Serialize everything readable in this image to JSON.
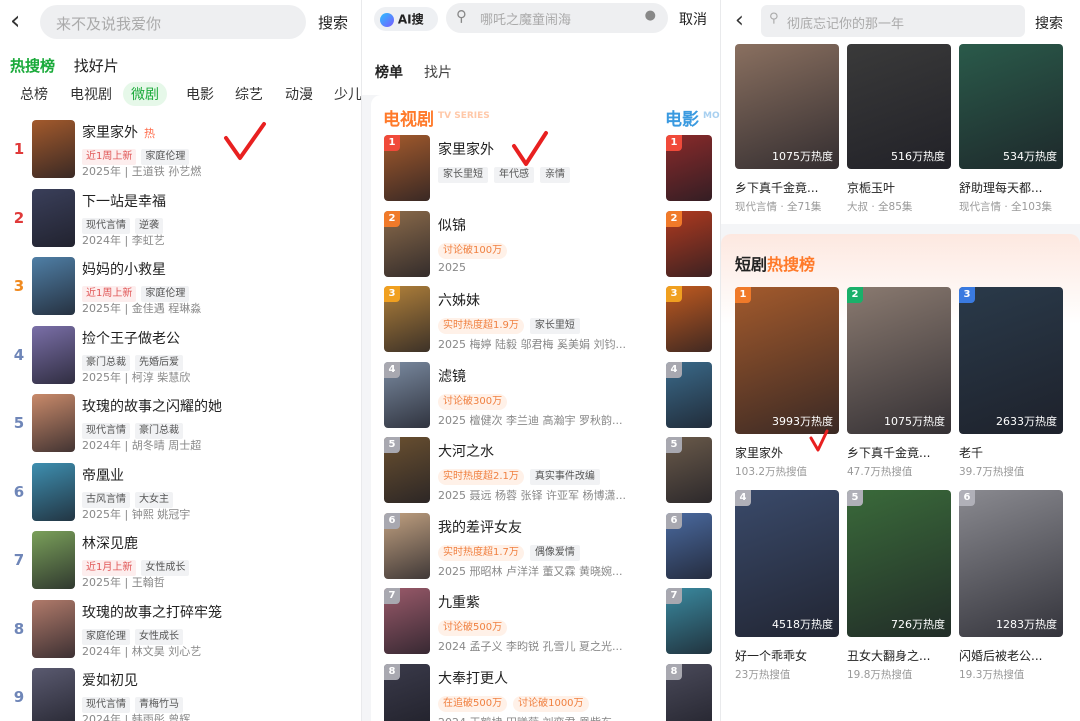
{
  "p1": {
    "search_placeholder": "来不及说我爱你",
    "search_label": "搜索",
    "tabs": [
      "热搜榜",
      "找好片"
    ],
    "categories": [
      "总榜",
      "电视剧",
      "微剧",
      "电影",
      "综艺",
      "动漫",
      "少儿"
    ],
    "items": [
      {
        "rank": "1",
        "title": "家里家外",
        "hot": "热",
        "tags": [
          "近1周上新",
          "家庭伦理"
        ],
        "meta": "2025年 | 王道铁 孙艺燃",
        "color": "#a35a2c"
      },
      {
        "rank": "2",
        "title": "下一站是幸福",
        "tags": [
          "现代言情",
          "逆袭"
        ],
        "meta": "2024年 | 李虹艺",
        "color": "#3a3f5a"
      },
      {
        "rank": "3",
        "title": "妈妈的小救星",
        "tags": [
          "近1周上新",
          "家庭伦理"
        ],
        "meta": "2025年 | 金佳遇 程琳淼",
        "color": "#4f7fa6"
      },
      {
        "rank": "4",
        "title": "捡个王子做老公",
        "tags": [
          "豪门总裁",
          "先婚后爱"
        ],
        "meta": "2025年 | 柯淳 柴慧欣",
        "color": "#7a6fa8"
      },
      {
        "rank": "5",
        "title": "玫瑰的故事之闪耀的她",
        "tags": [
          "现代言情",
          "豪门总裁"
        ],
        "meta": "2024年 | 胡冬晴 周士超",
        "color": "#c98a6a"
      },
      {
        "rank": "6",
        "title": "帝凰业",
        "tags": [
          "古风言情",
          "大女主"
        ],
        "meta": "2025年 | 钟熙 姚冠宇",
        "color": "#3e8fb0"
      },
      {
        "rank": "7",
        "title": "林深见鹿",
        "tags": [
          "近1月上新",
          "女性成长"
        ],
        "meta": "2025年 | 王翰哲",
        "color": "#7aa05a"
      },
      {
        "rank": "8",
        "title": "玫瑰的故事之打碎牢笼",
        "tags": [
          "家庭伦理",
          "女性成长"
        ],
        "meta": "2024年 | 林文昊 刘心艺",
        "color": "#b07a6a"
      },
      {
        "rank": "9",
        "title": "爱如初见",
        "tags": [
          "现代言情",
          "青梅竹马"
        ],
        "meta": "2024年 | 韩雨彤 曾辉",
        "color": "#5a5a70"
      }
    ]
  },
  "p2": {
    "ai_label": "AI搜",
    "search_placeholder": "哪吒之魔童闹海",
    "cancel_label": "取消",
    "tabs": [
      "榜单",
      "找片"
    ],
    "section_title": "电视剧",
    "section_sub": "TV SERIES",
    "next_section": "电影",
    "next_sub": "MO",
    "items": [
      {
        "rank": "1",
        "title": "家里家外",
        "chips": [
          [
            "g",
            "家长里短"
          ],
          [
            "g",
            "年代感"
          ],
          [
            "g",
            "亲情"
          ]
        ],
        "meta": "",
        "color": "#a35a2c"
      },
      {
        "rank": "2",
        "title": "似锦",
        "chips": [
          [
            "o",
            "讨论破100万"
          ]
        ],
        "meta": "2025",
        "color": "#8a6a4a"
      },
      {
        "rank": "3",
        "title": "六姊妹",
        "chips": [
          [
            "o",
            "实时热度超1.9万"
          ],
          [
            "g",
            "家长里短"
          ]
        ],
        "meta": "2025 梅婷 陆毅 邬君梅 奚美娟 刘钧...",
        "color": "#b0803a"
      },
      {
        "rank": "4",
        "title": "滤镜",
        "chips": [
          [
            "o",
            "讨论破300万"
          ]
        ],
        "meta": "2025 檀健次 李兰迪 高瀚宇 罗秋韵...",
        "color": "#7a8aa0"
      },
      {
        "rank": "5",
        "title": "大河之水",
        "chips": [
          [
            "o",
            "实时热度超2.1万"
          ],
          [
            "g",
            "真实事件改编"
          ]
        ],
        "meta": "2025 聂远 杨蓉 张铎 许亚军 杨博潇...",
        "color": "#6a5030"
      },
      {
        "rank": "6",
        "title": "我的差评女友",
        "chips": [
          [
            "o",
            "实时热度超1.7万"
          ],
          [
            "g",
            "偶像爱情"
          ]
        ],
        "meta": "2025 邢昭林 卢洋洋 董又霖 黄晓婉...",
        "color": "#c0a080"
      },
      {
        "rank": "7",
        "title": "九重紫",
        "chips": [
          [
            "o",
            "讨论破500万"
          ]
        ],
        "meta": "2024 孟子义 李昀锐 孔雪儿 夏之光...",
        "color": "#9a5a6a"
      },
      {
        "rank": "8",
        "title": "大奉打更人",
        "chips": [
          [
            "o",
            "在追破500万"
          ],
          [
            "o",
            "讨论破1000万"
          ]
        ],
        "meta": "2024 王鹤棣 田曦薇 刘奕君 凰紫东...",
        "color": "#3a3a4a"
      }
    ],
    "movie_colors": [
      "#8a2a2a",
      "#b03a20",
      "#c05a20",
      "#3a6a8a",
      "#6a5a4a",
      "#4a6aa0",
      "#3a8aa0",
      "#4a4a5a"
    ]
  },
  "p3": {
    "search_placeholder": "彻底忘记你的那一年",
    "search_label": "搜索",
    "top": [
      {
        "heat": "1075万热度",
        "name": "乡下真千金竟...",
        "sub": "现代言情 · 全71集",
        "color": "#8a7060"
      },
      {
        "heat": "516万热度",
        "name": "京栀玉叶",
        "sub": "大叔 · 全85集",
        "color": "#3a3a3a"
      },
      {
        "heat": "534万热度",
        "name": "舒助理每天都...",
        "sub": "现代言情 · 全103集",
        "color": "#2a5a4a"
      }
    ],
    "section_title_a": "短剧",
    "section_title_b": "热搜榜",
    "grid": [
      {
        "rank": "1",
        "heat": "3993万热度",
        "name": "家里家外",
        "sub": "103.2万热搜值",
        "color": "#a35a2c"
      },
      {
        "rank": "2",
        "heat": "1075万热度",
        "name": "乡下真千金竟...",
        "sub": "47.7万热搜值",
        "color": "#8a7a70"
      },
      {
        "rank": "3",
        "heat": "2633万热度",
        "name": "老千",
        "sub": "39.7万热搜值",
        "color": "#2a3a4a"
      },
      {
        "rank": "4",
        "heat": "4518万热度",
        "name": "好一个乖乖女",
        "sub": "23万热搜值",
        "color": "#3a4a6a"
      },
      {
        "rank": "5",
        "heat": "726万热度",
        "name": "丑女大翻身之...",
        "sub": "19.8万热搜值",
        "color": "#3a6a3a"
      },
      {
        "rank": "6",
        "heat": "1283万热度",
        "name": "闪婚后被老公...",
        "sub": "19.3万热搜值",
        "color": "#8a8a90"
      }
    ]
  },
  "colors": {
    "accent_green": "#1aaa3a",
    "rank_red": "#e03a3a",
    "rank_orange": "#f08a20",
    "rank_blue": "#6f86b8"
  }
}
